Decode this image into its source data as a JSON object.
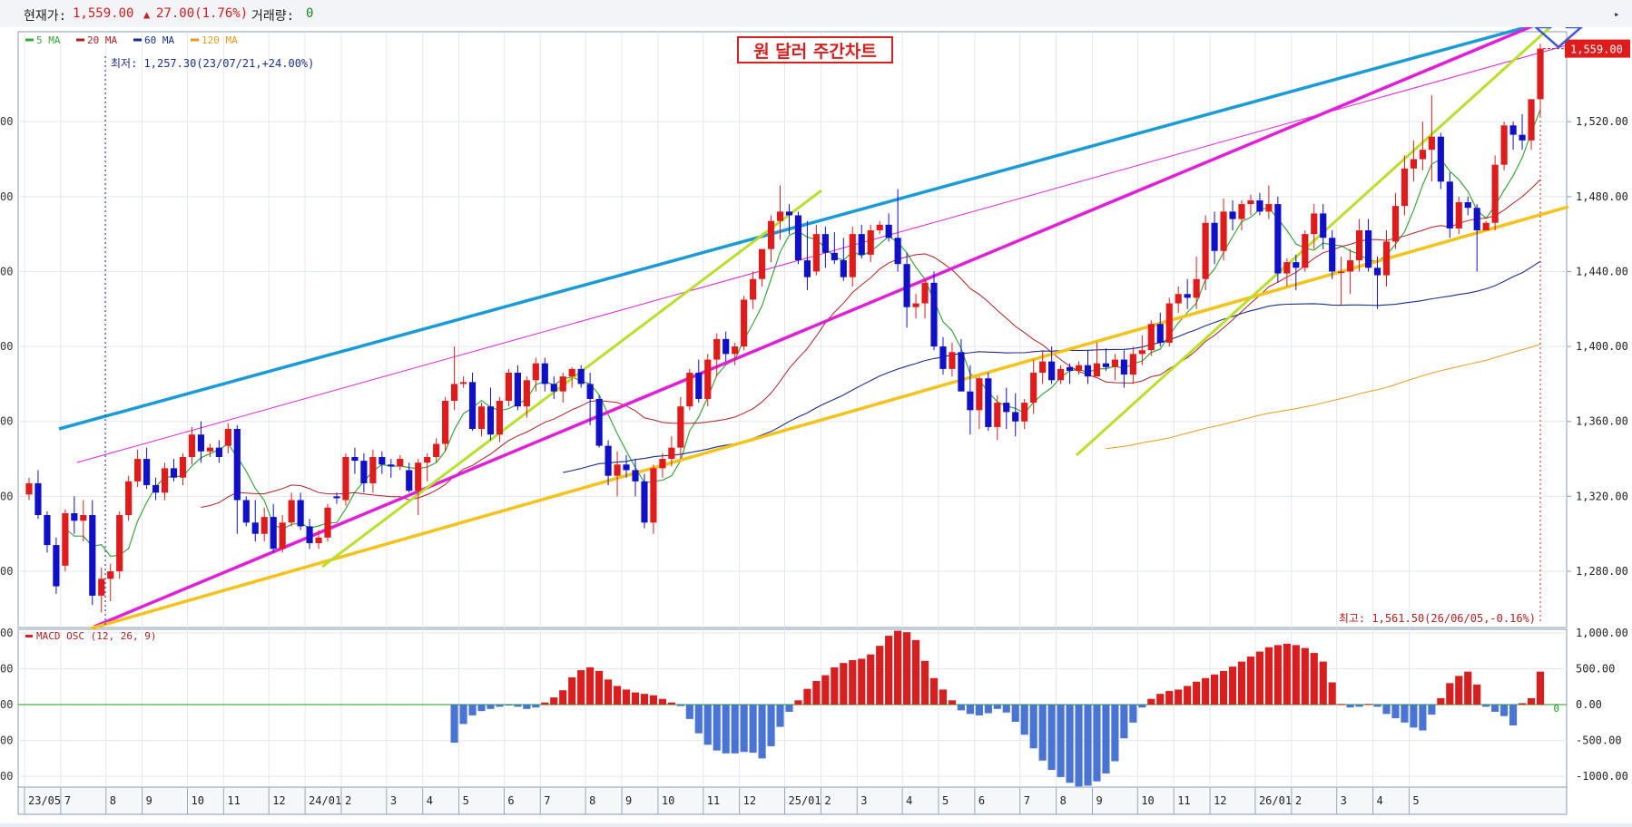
{
  "header": {
    "price_label": "현재가:",
    "price_value": "1,559.00",
    "change_icon": "up-triangle-icon",
    "change_value": "27.00(1.76%)",
    "volume_label": "거래량:",
    "volume_value": "0"
  },
  "colors": {
    "up": "#e01b1b",
    "down": "#1010c8",
    "ma5": "#3aa63a",
    "ma20": "#b02020",
    "ma60": "#1a2e8a",
    "ma120": "#e89a1c",
    "macd_pos": "#d81e1e",
    "macd_neg": "#4a74d4",
    "trend_blue": "#1a9ad6",
    "trend_magenta": "#e020d8",
    "trend_lime": "#b8e02a",
    "trend_yellow": "#f4c21a"
  },
  "chart_data": [
    {
      "type": "candlestick",
      "title": "원 달러 주간차트",
      "legend": [
        {
          "name": "5 MA",
          "color": "#3aa63a"
        },
        {
          "name": "20 MA",
          "color": "#b02020"
        },
        {
          "name": "60 MA",
          "color": "#1a2e8a"
        },
        {
          "name": "120 MA",
          "color": "#e89a1c"
        }
      ],
      "y_ticks": [
        1280,
        1320,
        1360,
        1400,
        1440,
        1480,
        1520
      ],
      "y_tick_labels": [
        "1,280.00",
        "1,320.00",
        "1,360.00",
        "1,400.00",
        "1,440.00",
        "1,480.00",
        "1,520.00"
      ],
      "ylim": [
        1250,
        1568
      ],
      "x_tick_labels": [
        "23/05",
        "7",
        "8",
        "9",
        "10",
        "11",
        "12",
        "24/01",
        "2",
        "3",
        "4",
        "5",
        "6",
        "7",
        "8",
        "9",
        "10",
        "11",
        "12",
        "25/01",
        "2",
        "3",
        "4",
        "5",
        "6",
        "7",
        "8",
        "9",
        "10",
        "11",
        "12",
        "26/01",
        "2",
        "3",
        "4",
        "5"
      ],
      "current_price_label": "1,559.00",
      "low_annotation": "최저: 1,257.30(23/07/21,+24.00%)",
      "high_annotation": "최고: 1,561.50(26/06/05,-0.16%)",
      "ohlc": [
        [
          1321,
          1330,
          1318,
          1327
        ],
        [
          1327,
          1334,
          1308,
          1310
        ],
        [
          1310,
          1312,
          1290,
          1294
        ],
        [
          1294,
          1298,
          1268,
          1272
        ],
        [
          1283,
          1313,
          1280,
          1311
        ],
        [
          1311,
          1320,
          1300,
          1307
        ],
        [
          1307,
          1318,
          1296,
          1310
        ],
        [
          1310,
          1318,
          1262,
          1267
        ],
        [
          1267,
          1282,
          1258,
          1276
        ],
        [
          1276,
          1284,
          1264,
          1280
        ],
        [
          1280,
          1312,
          1276,
          1310
        ],
        [
          1310,
          1331,
          1307,
          1328
        ],
        [
          1328,
          1345,
          1325,
          1340
        ],
        [
          1340,
          1346,
          1324,
          1326
        ],
        [
          1326,
          1330,
          1318,
          1322
        ],
        [
          1322,
          1338,
          1318,
          1335
        ],
        [
          1335,
          1340,
          1328,
          1330
        ],
        [
          1330,
          1343,
          1326,
          1341
        ],
        [
          1341,
          1357,
          1337,
          1353
        ],
        [
          1353,
          1360,
          1338,
          1344
        ],
        [
          1344,
          1348,
          1341,
          1346
        ],
        [
          1346,
          1350,
          1338,
          1341
        ],
        [
          1347,
          1359,
          1343,
          1356
        ],
        [
          1356,
          1358,
          1300,
          1318
        ],
        [
          1318,
          1320,
          1304,
          1306
        ],
        [
          1306,
          1318,
          1296,
          1300
        ],
        [
          1300,
          1314,
          1296,
          1309
        ],
        [
          1309,
          1316,
          1290,
          1292
        ],
        [
          1292,
          1310,
          1290,
          1306
        ],
        [
          1306,
          1322,
          1304,
          1318
        ],
        [
          1318,
          1322,
          1302,
          1304
        ],
        [
          1304,
          1308,
          1292,
          1295
        ],
        [
          1295,
          1302,
          1292,
          1298
        ],
        [
          1298,
          1316,
          1296,
          1314
        ],
        [
          1320,
          1322,
          1316,
          1319
        ],
        [
          1318,
          1343,
          1315,
          1341
        ],
        [
          1341,
          1346,
          1332,
          1339
        ],
        [
          1339,
          1343,
          1322,
          1327
        ],
        [
          1327,
          1345,
          1322,
          1341
        ],
        [
          1341,
          1344,
          1332,
          1337
        ],
        [
          1337,
          1340,
          1330,
          1336
        ],
        [
          1336,
          1342,
          1334,
          1340
        ],
        [
          1334,
          1338,
          1322,
          1323
        ],
        [
          1323,
          1340,
          1310,
          1338
        ],
        [
          1338,
          1343,
          1328,
          1341
        ],
        [
          1341,
          1351,
          1338,
          1348
        ],
        [
          1348,
          1373,
          1344,
          1371
        ],
        [
          1371,
          1400,
          1366,
          1380
        ],
        [
          1380,
          1384,
          1378,
          1381
        ],
        [
          1381,
          1386,
          1355,
          1356
        ],
        [
          1356,
          1370,
          1352,
          1368
        ],
        [
          1368,
          1378,
          1350,
          1353
        ],
        [
          1353,
          1373,
          1349,
          1371
        ],
        [
          1371,
          1388,
          1368,
          1386
        ],
        [
          1386,
          1390,
          1366,
          1368
        ],
        [
          1368,
          1384,
          1362,
          1382
        ],
        [
          1382,
          1394,
          1376,
          1391
        ],
        [
          1391,
          1394,
          1376,
          1380
        ],
        [
          1380,
          1384,
          1372,
          1376
        ],
        [
          1376,
          1386,
          1370,
          1384
        ],
        [
          1384,
          1389,
          1378,
          1388
        ],
        [
          1388,
          1390,
          1378,
          1380
        ],
        [
          1380,
          1386,
          1358,
          1372
        ],
        [
          1372,
          1374,
          1346,
          1347
        ],
        [
          1347,
          1350,
          1326,
          1331
        ],
        [
          1331,
          1344,
          1320,
          1337
        ],
        [
          1337,
          1342,
          1330,
          1334
        ],
        [
          1334,
          1340,
          1320,
          1328
        ],
        [
          1328,
          1332,
          1303,
          1306
        ],
        [
          1306,
          1337,
          1300,
          1335
        ],
        [
          1335,
          1343,
          1330,
          1340
        ],
        [
          1340,
          1352,
          1336,
          1346
        ],
        [
          1346,
          1373,
          1340,
          1368
        ],
        [
          1368,
          1388,
          1366,
          1386
        ],
        [
          1386,
          1393,
          1370,
          1372
        ],
        [
          1372,
          1396,
          1368,
          1393
        ],
        [
          1393,
          1407,
          1384,
          1404
        ],
        [
          1404,
          1408,
          1392,
          1396
        ],
        [
          1396,
          1402,
          1390,
          1400
        ],
        [
          1400,
          1427,
          1398,
          1425
        ],
        [
          1425,
          1440,
          1420,
          1436
        ],
        [
          1436,
          1452,
          1432,
          1452
        ],
        [
          1452,
          1470,
          1445,
          1467
        ],
        [
          1467,
          1486,
          1457,
          1472
        ],
        [
          1472,
          1476,
          1460,
          1470
        ],
        [
          1470,
          1472,
          1444,
          1446
        ],
        [
          1446,
          1467,
          1430,
          1437
        ],
        [
          1440,
          1465,
          1438,
          1460
        ],
        [
          1460,
          1464,
          1442,
          1450
        ],
        [
          1450,
          1461,
          1444,
          1446
        ],
        [
          1446,
          1458,
          1435,
          1437
        ],
        [
          1437,
          1464,
          1432,
          1460
        ],
        [
          1460,
          1465,
          1447,
          1449
        ],
        [
          1449,
          1465,
          1445,
          1462
        ],
        [
          1462,
          1467,
          1460,
          1465
        ],
        [
          1465,
          1471,
          1456,
          1458
        ],
        [
          1458,
          1484,
          1440,
          1444
        ],
        [
          1444,
          1450,
          1410,
          1421
        ],
        [
          1421,
          1428,
          1415,
          1423
        ],
        [
          1423,
          1436,
          1415,
          1434
        ],
        [
          1434,
          1440,
          1398,
          1400
        ],
        [
          1400,
          1405,
          1385,
          1388
        ],
        [
          1388,
          1402,
          1384,
          1397
        ],
        [
          1397,
          1404,
          1376,
          1376
        ],
        [
          1376,
          1390,
          1353,
          1366
        ],
        [
          1366,
          1384,
          1356,
          1383
        ],
        [
          1383,
          1386,
          1355,
          1357
        ],
        [
          1357,
          1374,
          1350,
          1370
        ],
        [
          1370,
          1378,
          1356,
          1365
        ],
        [
          1365,
          1375,
          1352,
          1360
        ],
        [
          1360,
          1372,
          1356,
          1370
        ],
        [
          1370,
          1393,
          1364,
          1386
        ],
        [
          1386,
          1398,
          1380,
          1392
        ],
        [
          1392,
          1400,
          1380,
          1382
        ],
        [
          1382,
          1390,
          1380,
          1388
        ],
        [
          1389,
          1391,
          1380,
          1387
        ],
        [
          1387,
          1392,
          1385,
          1390
        ],
        [
          1390,
          1398,
          1380,
          1384
        ],
        [
          1384,
          1402,
          1384,
          1391
        ],
        [
          1391,
          1399,
          1387,
          1389
        ],
        [
          1389,
          1396,
          1382,
          1393
        ],
        [
          1393,
          1398,
          1378,
          1385
        ],
        [
          1385,
          1400,
          1380,
          1396
        ],
        [
          1396,
          1406,
          1390,
          1398
        ],
        [
          1398,
          1414,
          1395,
          1412
        ],
        [
          1412,
          1418,
          1400,
          1402
        ],
        [
          1402,
          1426,
          1400,
          1423
        ],
        [
          1423,
          1432,
          1418,
          1428
        ],
        [
          1428,
          1436,
          1420,
          1426
        ],
        [
          1426,
          1448,
          1420,
          1436
        ],
        [
          1436,
          1470,
          1430,
          1466
        ],
        [
          1466,
          1472,
          1444,
          1451
        ],
        [
          1451,
          1479,
          1446,
          1472
        ],
        [
          1472,
          1478,
          1462,
          1468
        ],
        [
          1468,
          1478,
          1462,
          1476
        ],
        [
          1476,
          1481,
          1470,
          1478
        ],
        [
          1478,
          1482,
          1470,
          1472
        ],
        [
          1472,
          1486,
          1468,
          1476
        ],
        [
          1476,
          1480,
          1434,
          1439
        ],
        [
          1439,
          1447,
          1432,
          1445
        ],
        [
          1445,
          1449,
          1430,
          1442
        ],
        [
          1442,
          1462,
          1440,
          1460
        ],
        [
          1460,
          1476,
          1452,
          1471
        ],
        [
          1471,
          1476,
          1452,
          1458
        ],
        [
          1458,
          1462,
          1436,
          1440
        ],
        [
          1440,
          1448,
          1422,
          1440
        ],
        [
          1440,
          1452,
          1428,
          1446
        ],
        [
          1446,
          1468,
          1440,
          1462
        ],
        [
          1462,
          1468,
          1440,
          1442
        ],
        [
          1442,
          1448,
          1420,
          1438
        ],
        [
          1438,
          1462,
          1432,
          1456
        ],
        [
          1456,
          1482,
          1452,
          1475
        ],
        [
          1475,
          1502,
          1470,
          1495
        ],
        [
          1495,
          1510,
          1488,
          1500
        ],
        [
          1500,
          1520,
          1494,
          1505
        ],
        [
          1505,
          1534,
          1488,
          1512
        ],
        [
          1512,
          1514,
          1484,
          1488
        ],
        [
          1488,
          1493,
          1458,
          1463
        ],
        [
          1463,
          1480,
          1460,
          1477
        ],
        [
          1477,
          1480,
          1470,
          1474
        ],
        [
          1474,
          1476,
          1440,
          1462
        ],
        [
          1462,
          1467,
          1462,
          1466
        ],
        [
          1466,
          1502,
          1462,
          1497
        ],
        [
          1497,
          1520,
          1494,
          1518
        ],
        [
          1518,
          1520,
          1505,
          1513
        ],
        [
          1513,
          1524,
          1505,
          1510
        ],
        [
          1510,
          1531,
          1505,
          1532
        ],
        [
          1532,
          1561.5,
          1523,
          1559
        ]
      ],
      "macd_panel": {
        "label": "MACD OSC (12, 26, 9)",
        "ylim": [
          -1150,
          1050
        ],
        "y_ticks": [
          1000,
          500,
          0,
          -500,
          -1000
        ],
        "y_tick_labels": [
          "1,000.00",
          "500.00",
          "0.00",
          "-500.00",
          "-1000.00"
        ],
        "zero_label": "0",
        "values": [
          -530,
          -270,
          -150,
          -90,
          -60,
          -30,
          -10,
          -30,
          -60,
          -40,
          30,
          100,
          200,
          380,
          480,
          520,
          470,
          350,
          260,
          210,
          170,
          150,
          130,
          80,
          30,
          -20,
          -200,
          -400,
          -560,
          -640,
          -680,
          -680,
          -660,
          -670,
          -750,
          -580,
          -310,
          -100,
          60,
          220,
          330,
          410,
          520,
          580,
          620,
          640,
          700,
          820,
          960,
          1030,
          1010,
          900,
          610,
          370,
          210,
          60,
          -80,
          -130,
          -150,
          -120,
          -60,
          -110,
          -240,
          -420,
          -610,
          -780,
          -910,
          -1010,
          -1090,
          -1140,
          -1130,
          -1070,
          -960,
          -790,
          -470,
          -250,
          -40,
          80,
          150,
          190,
          210,
          260,
          320,
          370,
          420,
          470,
          530,
          600,
          670,
          740,
          800,
          830,
          850,
          830,
          790,
          720,
          600,
          310,
          10,
          -40,
          -30,
          10,
          -30,
          -130,
          -190,
          -250,
          -320,
          -360,
          -140,
          90,
          300,
          400,
          460,
          280,
          -30,
          -100,
          -160,
          -290,
          20,
          90,
          460
        ]
      }
    }
  ]
}
